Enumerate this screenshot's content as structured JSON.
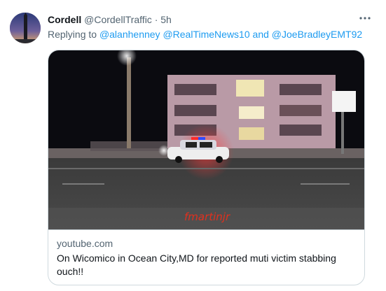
{
  "tweet": {
    "author_name": "Cordell",
    "author_handle": "@CordellTraffic",
    "separator": "·",
    "time": "5h",
    "more_icon": "more-horizontal-icon",
    "reply_prefix": "Replying to",
    "mentions": [
      "@alanhenney",
      "@RealTimeNews10",
      "@JoeBradleyEMT92"
    ],
    "mention_joiner_1": " ",
    "mention_joiner_2": " and "
  },
  "card": {
    "watermark": "fmartinjr",
    "domain": "youtube.com",
    "title": "On Wicomico in Ocean City,MD for reported muti victim stabbing ouch!!"
  },
  "colors": {
    "link": "#1d9bf0",
    "secondary_text": "#536471",
    "border": "#cfd9de",
    "watermark": "#e1301e"
  }
}
